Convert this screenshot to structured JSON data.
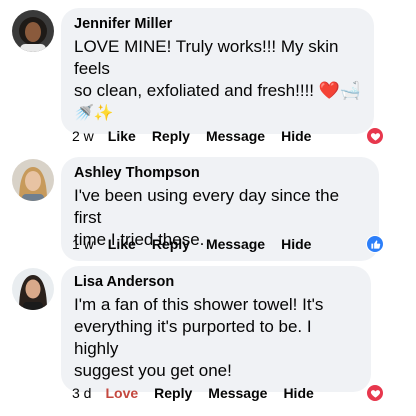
{
  "comments": [
    {
      "author": "Jennifer Miller",
      "lines": [
        "LOVE MINE! Truly works!!! My skin feels",
        "so clean, exfoliated and fresh!!!! ❤️🛁"
      ],
      "extra": "🚿✨",
      "time": "2 w",
      "actions": {
        "like": "Like",
        "reply": "Reply",
        "message": "Message",
        "hide": "Hide"
      },
      "reaction": "heart"
    },
    {
      "author": "Ashley Thompson",
      "lines": [
        "I've been using every day since the first",
        "time I tried these."
      ],
      "time": "1 w",
      "actions": {
        "like": "Like",
        "reply": "Reply",
        "message": "Message",
        "hide": "Hide"
      },
      "reaction": "like"
    },
    {
      "author": "Lisa Anderson",
      "lines": [
        "I'm a fan of this shower towel! It's",
        "everything it's purported to be. I highly",
        "suggest you get one!"
      ],
      "time": "3 d",
      "actions": {
        "like": "Love",
        "reply": "Reply",
        "message": "Message",
        "hide": "Hide"
      },
      "reaction": "heart"
    }
  ],
  "colors": {
    "bubble": "#f0f2f5",
    "love_text": "#c4483f",
    "heart_badge": "#e7374d",
    "like_badge": "#2d7ff9"
  },
  "icons": {
    "heart": "heart-icon",
    "like": "thumbs-up-icon"
  }
}
